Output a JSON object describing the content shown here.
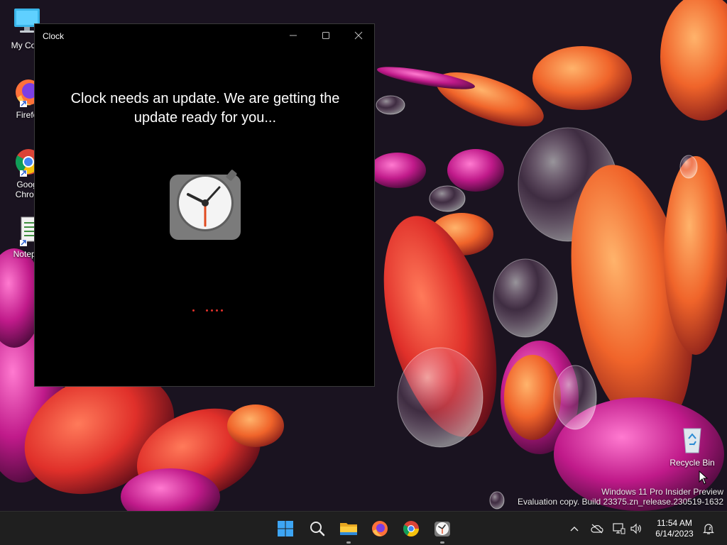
{
  "desktop": {
    "icons": [
      {
        "label": "My Com",
        "icon": "computer-icon"
      },
      {
        "label": "Firefo",
        "icon": "firefox-icon"
      },
      {
        "label": "Goog",
        "label2": "Chron",
        "icon": "chrome-icon"
      },
      {
        "label": "Notepa",
        "icon": "notepad-icon"
      },
      {
        "label": "Recycle Bin",
        "icon": "recycle-bin-icon"
      }
    ]
  },
  "window": {
    "title": "Clock",
    "message": "Clock needs an update. We are getting the update ready for you...",
    "controls": [
      "minimize-icon",
      "maximize-icon",
      "close-icon"
    ],
    "loading_color": "#e0322b"
  },
  "watermark": {
    "line1": "Windows 11 Pro Insider Preview",
    "line2": "Evaluation copy. Build 23375.zn_release.230519-1632"
  },
  "taskbar": {
    "apps": [
      "start-icon",
      "search-icon",
      "file-explorer-icon",
      "firefox-icon",
      "chrome-icon",
      "clock-app-icon"
    ],
    "tray": [
      "chevron-up-icon",
      "network-off-icon",
      "display-icon",
      "speaker-icon",
      "notification-icon"
    ],
    "time": "11:54 AM",
    "date": "6/14/2023"
  }
}
